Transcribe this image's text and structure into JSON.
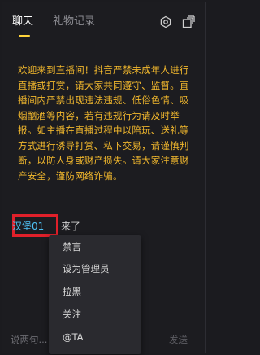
{
  "tabs": {
    "chat": "聊天",
    "gift_record": "礼物记录"
  },
  "icons": {
    "settings": "settings-icon",
    "popout": "popout-icon"
  },
  "notice": {
    "text": "欢迎来到直播间！抖音严禁未成年人进行直播或打赏，请大家共同遵守、监督。直播间内严禁出现违法违规、低俗色情、吸烟酗酒等内容，若有违规行为请及时举报。如主播在直播过程中以陪玩、送礼等方式进行诱导打赏、私下交易，请谨慎判断，以防人身或财产损失。请大家注意财产安全，谨防网络诈骗。"
  },
  "message": {
    "username": "汉堡01",
    "action": "来了"
  },
  "context_menu": {
    "items": [
      "禁言",
      "设为管理员",
      "拉黑",
      "关注",
      "@TA"
    ]
  },
  "input": {
    "placeholder": "说两句...",
    "send_label": "发送"
  },
  "colors": {
    "background": "#1c1c20",
    "notice": "#f2b82d",
    "username": "#4fc3f7",
    "highlight": "#e0202a",
    "tab_underline": "#ffd43b"
  }
}
